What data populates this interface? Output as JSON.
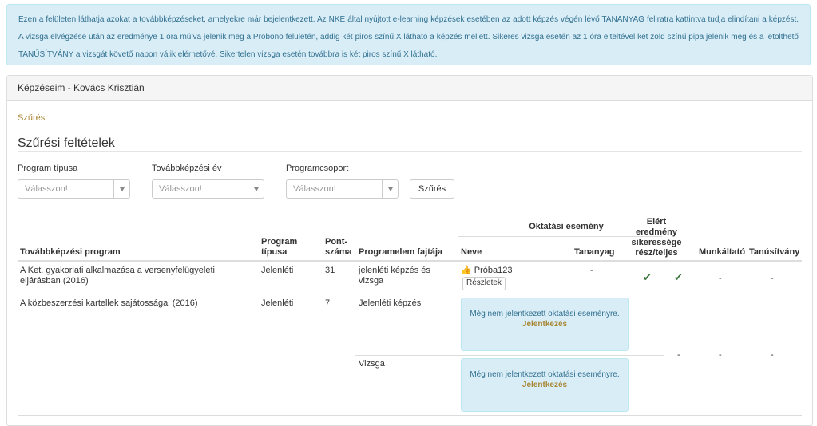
{
  "info_alert": {
    "text": "Ezen a felületen láthatja azokat a továbbképzéseket, amelyekre már bejelentkezett. Az NKE által nyújtott e-learning képzések esetében az adott képzés végén lévő TANANYAG feliratra kattintva tudja elindítani a képzést. A vizsga elvégzése után az eredménye 1 óra múlva jelenik meg a Probono felületén, addig két piros színű X látható a képzés mellett. Sikeres vizsga esetén az 1 óra elteltével két zöld színű pipa jelenik meg és a letölthető TANÚSÍTVÁNY a vizsgát követő napon válik elérhetővé. Sikertelen vizsga esetén továbbra is két piros színű X látható."
  },
  "panel": {
    "title": "Képzéseim - Kovács Krisztián"
  },
  "filter": {
    "link": "Szűrés",
    "title": "Szűrési feltételek",
    "fields": [
      {
        "label": "Program típusa",
        "value": "Válasszon!"
      },
      {
        "label": "Továbbképzési év",
        "value": "Válasszon!"
      },
      {
        "label": "Programcsoport",
        "value": "Válasszon!"
      }
    ],
    "button": "Szűrés"
  },
  "table": {
    "headers": {
      "program": "Továbbképzési program",
      "type": "Program típusa",
      "points": "Pont-száma",
      "element": "Programelem fajtája",
      "event_group": "Oktatási esemény",
      "event_name": "Neve",
      "material": "Tananyag",
      "result": "Elért eredmény sikeressége rész/teljes",
      "employer": "Munkáltató",
      "certificate": "Tanúsítvány"
    },
    "rows": [
      {
        "program": "A Ket. gyakorlati alkalmazása a versenyfelügyeleti eljárásban (2016)",
        "type": "Jelenléti",
        "points": "31",
        "element": "jelenléti képzés és vizsga",
        "event_name": "Próba123",
        "details_button": "Részletek",
        "material": "-",
        "result_partial": "✔",
        "result_full": "✔",
        "employer": "-",
        "certificate": "-"
      },
      {
        "program": "A közbeszerzési kartellek sajátosságai (2016)",
        "type": "Jelenléti",
        "points": "7",
        "elements": [
          {
            "element": "Jelenléti képzés",
            "info": "Még nem jelentkezett oktatási eseményre.",
            "link": "Jelentkezés"
          },
          {
            "element": "Vizsga",
            "info": "Még nem jelentkezett oktatási eseményre.",
            "link": "Jelentkezés"
          }
        ],
        "result": "-",
        "employer": "-",
        "certificate": "-"
      }
    ]
  },
  "colors": {
    "info_bg": "#d9edf7",
    "info_text": "#31708f",
    "link": "#a88734",
    "success": "#3c763d"
  },
  "icons": {
    "thumbs_up": "thumbs-up-icon",
    "check": "check-icon",
    "caret": "caret-down-icon"
  }
}
